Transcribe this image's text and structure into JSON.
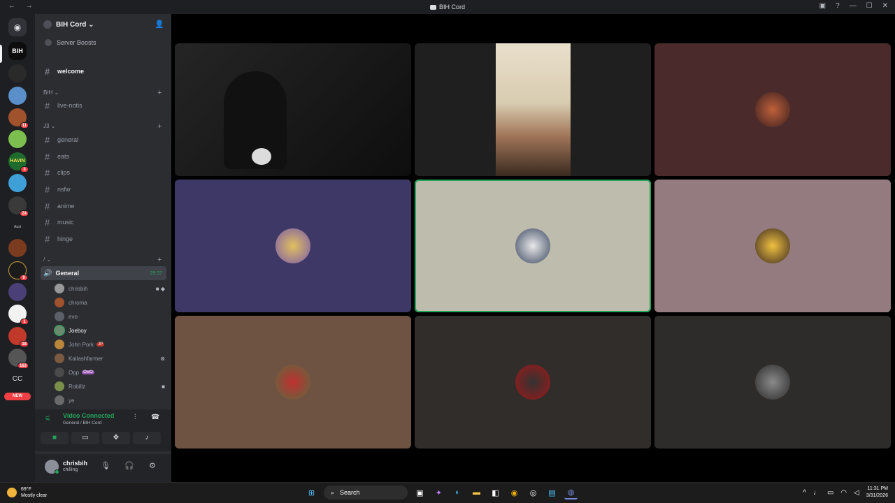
{
  "window": {
    "title": "BIH Cord",
    "nav_buttons": "← →"
  },
  "server": {
    "name": "BIH Cord ⌄",
    "boosts_label": "Server Boosts"
  },
  "server_list": {
    "badges": [
      "11",
      "3",
      "24",
      "9",
      "1",
      "18",
      "163"
    ],
    "cc_label": "CC",
    "new_label": "NEW"
  },
  "channels": {
    "welcome": "welcome",
    "cat_bih": "BIH ⌄",
    "live_notis": "live-notis",
    "cat_2": "J3 ⌄",
    "general": "general",
    "eats": "eats",
    "clips": "clips",
    "nsfw": "nsfw",
    "anime": "anime",
    "music": "music",
    "hinge": "hinge",
    "cat_3": "/ ⌄"
  },
  "voice_channel": {
    "name": "General",
    "timer": "29:37",
    "users": [
      {
        "name": "chrisbih",
        "extra": ""
      },
      {
        "name": "chroma",
        "extra": ""
      },
      {
        "name": "evo",
        "extra": ""
      },
      {
        "name": "Joeboy",
        "extra": ""
      },
      {
        "name": "John Pork",
        "extra": "JP"
      },
      {
        "name": "Kailashfarmer",
        "extra": ""
      },
      {
        "name": "Opp",
        "extra": "OwO"
      },
      {
        "name": "Robillz",
        "extra": ""
      },
      {
        "name": "ye",
        "extra": ""
      }
    ]
  },
  "connection": {
    "status": "Video Connected",
    "location": "General / BIH Cord"
  },
  "user": {
    "name": "chrisbih",
    "status": "chilling"
  },
  "taskbar": {
    "temp": "69°F",
    "weather": "Mostly clear",
    "search_label": "Search",
    "time": "11:31 PM",
    "date": "3/31/2026"
  },
  "colors": {
    "tile_1": "#1a1a1a",
    "tile_2": "#1f1f1f",
    "tile_3": "#4a2a2b",
    "tile_4": "#3d3865",
    "tile_5": "#bdbcad",
    "tile_6": "#947b80",
    "tile_7": "#6e5242",
    "tile_8": "#302d2b",
    "tile_9": "#2e2c2a",
    "speaking": "#23a55a"
  }
}
